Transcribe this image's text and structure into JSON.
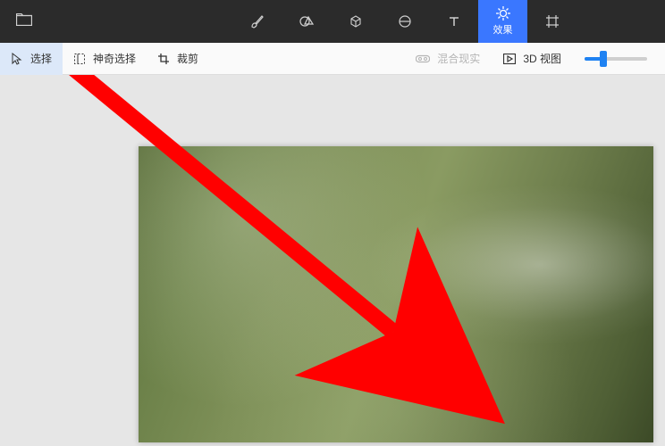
{
  "topbar": {
    "tools": [
      {
        "name": "brush-icon"
      },
      {
        "name": "shapes2d-icon"
      },
      {
        "name": "shapes3d-icon"
      },
      {
        "name": "stickers-icon"
      },
      {
        "name": "text-icon"
      },
      {
        "name": "effects-icon",
        "label": "效果",
        "active": true
      },
      {
        "name": "canvas-icon"
      }
    ]
  },
  "subbar": {
    "select_label": "选择",
    "magic_select_label": "神奇选择",
    "crop_label": "裁剪",
    "mixed_reality_label": "混合现实",
    "view3d_label": "3D 视图",
    "zoom_pct": 30
  }
}
